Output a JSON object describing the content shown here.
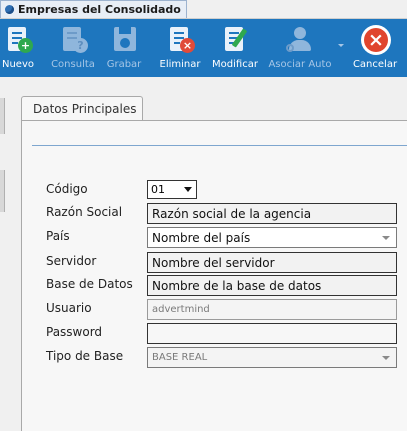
{
  "window": {
    "title": "Empresas del Consolidado"
  },
  "toolbar": {
    "buttons": [
      {
        "label": "Nuevo",
        "enabled": true
      },
      {
        "label": "Consulta",
        "enabled": false
      },
      {
        "label": "Grabar",
        "enabled": false
      },
      {
        "label": "Eliminar",
        "enabled": true
      },
      {
        "label": "Modificar",
        "enabled": true
      },
      {
        "label": "Asociar Auto",
        "enabled": false
      },
      {
        "label": "Cancelar",
        "enabled": true
      }
    ]
  },
  "tabs": [
    {
      "label": "Datos Principales",
      "active": true
    }
  ],
  "form": {
    "codigo": {
      "label": "Código",
      "value": "01"
    },
    "razon_social": {
      "label": "Razón Social",
      "value": "Razón social de la agencia"
    },
    "pais": {
      "label": "País",
      "value": "Nombre del país"
    },
    "servidor": {
      "label": "Servidor",
      "value": "Nombre del servidor"
    },
    "base_datos": {
      "label": "Base de Datos",
      "value": "Nombre de la base de datos"
    },
    "usuario": {
      "label": "Usuario",
      "value": "advertmind"
    },
    "password": {
      "label": "Password",
      "value": ""
    },
    "tipo_base": {
      "label": "Tipo de Base",
      "value": "BASE REAL"
    }
  },
  "colors": {
    "toolbar_bg": "#1e76be",
    "accent_green": "#2fa84f",
    "cancel_red": "#e0452e",
    "delete_red": "#e04b3a"
  }
}
